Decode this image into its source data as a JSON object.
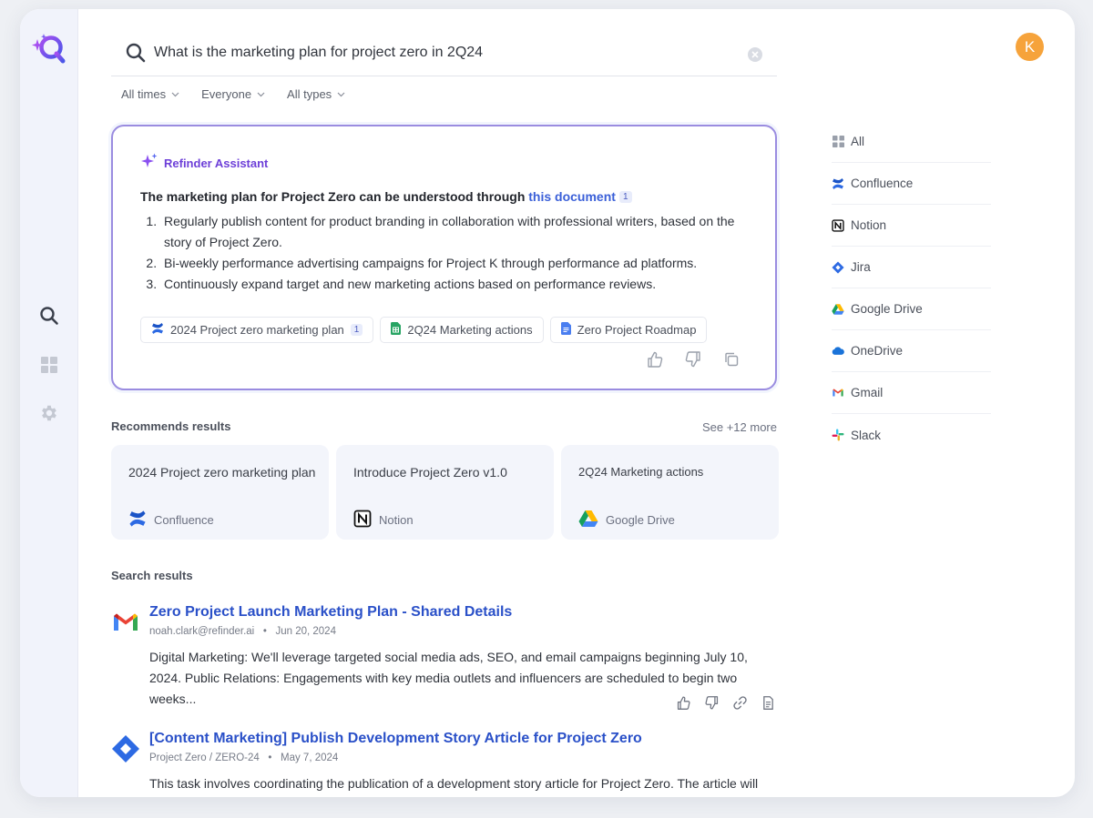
{
  "search": {
    "query": "What is the marketing plan for project zero in 2Q24"
  },
  "filters": [
    {
      "label": "All times"
    },
    {
      "label": "Everyone"
    },
    {
      "label": "All types"
    }
  ],
  "assistant": {
    "title": "Refinder Assistant",
    "lead_text": "The marketing plan for Project Zero can be understood through ",
    "lead_link": "this document",
    "lead_badge": "1",
    "points": [
      "Regularly publish content for product branding in collaboration with professional writers, based on the story of Project Zero.",
      "Bi-weekly performance advertising campaigns for Project K through performance ad platforms.",
      "Continuously expand target and new marketing actions based on performance reviews."
    ],
    "references": [
      {
        "label": "2024 Project zero marketing plan",
        "badge": "1",
        "icon": "confluence-icon"
      },
      {
        "label": "2Q24 Marketing actions",
        "icon": "google-sheets-icon"
      },
      {
        "label": "Zero Project Roadmap",
        "icon": "google-docs-icon"
      }
    ]
  },
  "recommends": {
    "title": "Recommends results",
    "see_more": "See +12 more",
    "items": [
      {
        "title": "2024 Project zero marketing plan",
        "source": "Confluence",
        "icon": "confluence-icon"
      },
      {
        "title": "Introduce Project Zero v1.0",
        "source": "Notion",
        "icon": "notion-icon"
      },
      {
        "title": "2Q24 Marketing actions",
        "source": "Google Drive",
        "icon": "google-drive-icon"
      }
    ]
  },
  "results": {
    "title": "Search results",
    "items": [
      {
        "title": "Zero Project Launch Marketing Plan - Shared Details",
        "author": "noah.clark@refinder.ai",
        "date": "Jun 20, 2024",
        "snippet": "Digital Marketing: We'll leverage targeted social media ads, SEO, and email campaigns beginning July 10, 2024. Public Relations: Engagements with key media outlets and influencers are scheduled to begin two weeks...",
        "icon": "gmail-icon"
      },
      {
        "title": "[Content Marketing] Publish Development Story Article for Project Zero",
        "author": "Project Zero / ZERO-24",
        "date": "May 7, 2024",
        "snippet": "This task involves coordinating the publication of a development story article for Project Zero. The article will",
        "icon": "jira-icon"
      }
    ]
  },
  "user": {
    "initial": "K"
  },
  "sources": [
    {
      "label": "All",
      "icon": "grid-icon"
    },
    {
      "label": "Confluence",
      "icon": "confluence-icon"
    },
    {
      "label": "Notion",
      "icon": "notion-icon"
    },
    {
      "label": "Jira",
      "icon": "jira-icon"
    },
    {
      "label": "Google Drive",
      "icon": "google-drive-icon"
    },
    {
      "label": "OneDrive",
      "icon": "onedrive-icon"
    },
    {
      "label": "Gmail",
      "icon": "gmail-icon"
    },
    {
      "label": "Slack",
      "icon": "slack-icon"
    }
  ],
  "colors": {
    "accent": "#6d3fd8",
    "link": "#2a50c8",
    "avatar": "#f6a33b",
    "card_border": "#9a8ce0"
  }
}
